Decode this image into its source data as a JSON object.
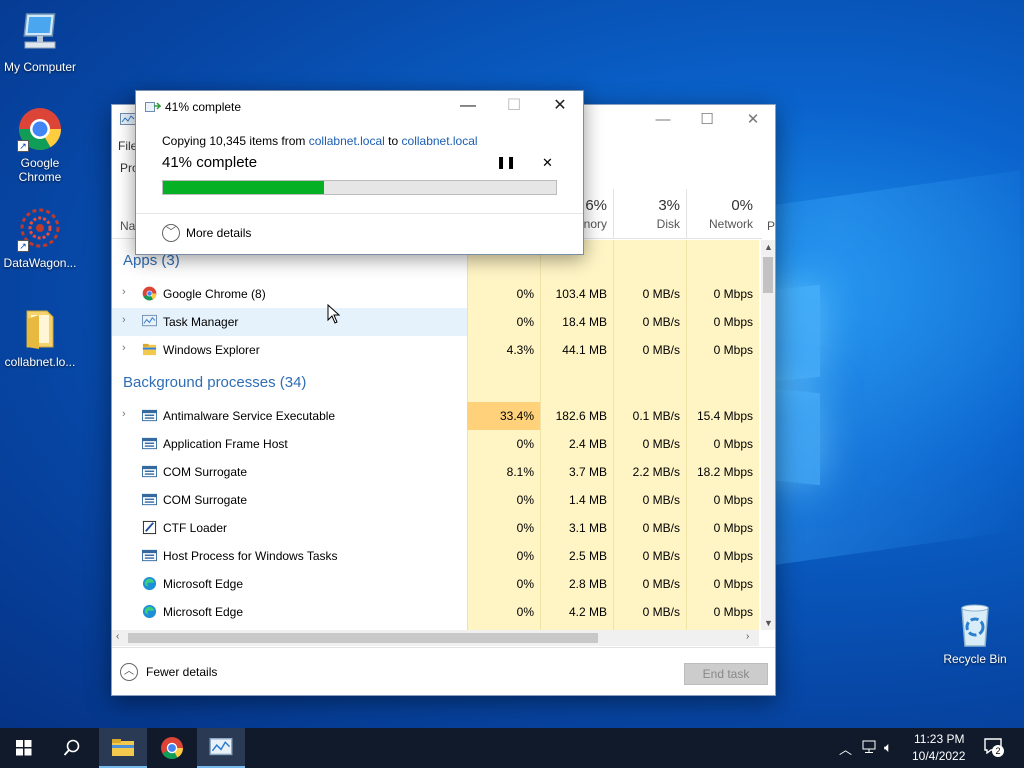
{
  "desktop": {
    "icons": [
      {
        "label": "My Computer",
        "icon": "computer-icon"
      },
      {
        "label": "Google Chrome",
        "icon": "chrome-icon"
      },
      {
        "label": "DataWagon...",
        "icon": "datawagon-icon"
      },
      {
        "label": "collabnet.lo...",
        "icon": "folder-icon"
      },
      {
        "label": "Recycle Bin",
        "icon": "recycle-bin-icon"
      }
    ]
  },
  "task_manager": {
    "menu_first": "File",
    "tab_first": "Pro",
    "header": {
      "name_label": "Na",
      "memory_pct": "6%",
      "memory_label": "nory",
      "disk_pct": "3%",
      "disk_label": "Disk",
      "network_pct": "0%",
      "network_label": "Network",
      "power_label": "P"
    },
    "groups": {
      "apps": "Apps (3)",
      "background": "Background processes (34)"
    },
    "apps": [
      {
        "name": "Google Chrome (8)",
        "cpu": "0%",
        "memory": "103.4 MB",
        "disk": "0 MB/s",
        "network": "0 Mbps"
      },
      {
        "name": "Task Manager",
        "cpu": "0%",
        "memory": "18.4 MB",
        "disk": "0 MB/s",
        "network": "0 Mbps"
      },
      {
        "name": "Windows Explorer",
        "cpu": "4.3%",
        "memory": "44.1 MB",
        "disk": "0 MB/s",
        "network": "0 Mbps"
      }
    ],
    "background": [
      {
        "name": "Antimalware Service Executable",
        "cpu": "33.4%",
        "memory": "182.6 MB",
        "disk": "0.1 MB/s",
        "network": "15.4 Mbps"
      },
      {
        "name": "Application Frame Host",
        "cpu": "0%",
        "memory": "2.4 MB",
        "disk": "0 MB/s",
        "network": "0 Mbps"
      },
      {
        "name": "COM Surrogate",
        "cpu": "8.1%",
        "memory": "3.7 MB",
        "disk": "2.2 MB/s",
        "network": "18.2 Mbps"
      },
      {
        "name": "COM Surrogate",
        "cpu": "0%",
        "memory": "1.4 MB",
        "disk": "0 MB/s",
        "network": "0 Mbps"
      },
      {
        "name": "CTF Loader",
        "cpu": "0%",
        "memory": "3.1 MB",
        "disk": "0 MB/s",
        "network": "0 Mbps"
      },
      {
        "name": "Host Process for Windows Tasks",
        "cpu": "0%",
        "memory": "2.5 MB",
        "disk": "0 MB/s",
        "network": "0 Mbps"
      },
      {
        "name": "Microsoft Edge",
        "cpu": "0%",
        "memory": "2.8 MB",
        "disk": "0 MB/s",
        "network": "0 Mbps"
      },
      {
        "name": "Microsoft Edge",
        "cpu": "0%",
        "memory": "4.2 MB",
        "disk": "0 MB/s",
        "network": "0 Mbps"
      }
    ],
    "fewer_details": "Fewer details",
    "end_task": "End task"
  },
  "copy_dialog": {
    "title": "41% complete",
    "copying_prefix": "Copying 10,345 items from",
    "source": "collabnet.local",
    "to_word": "to",
    "destination": "collabnet.local",
    "status": "41% complete",
    "progress": 0.41,
    "more_details": "More details"
  },
  "taskbar": {
    "time": "11:23 PM",
    "date": "10/4/2022",
    "notification_count": "2"
  },
  "colors": {
    "progress_fill": "#06b025",
    "link": "#1a5fb4",
    "group_header": "#2f6eb5",
    "heat_low": "#fff4c4",
    "heat_high": "#ffd17a"
  }
}
